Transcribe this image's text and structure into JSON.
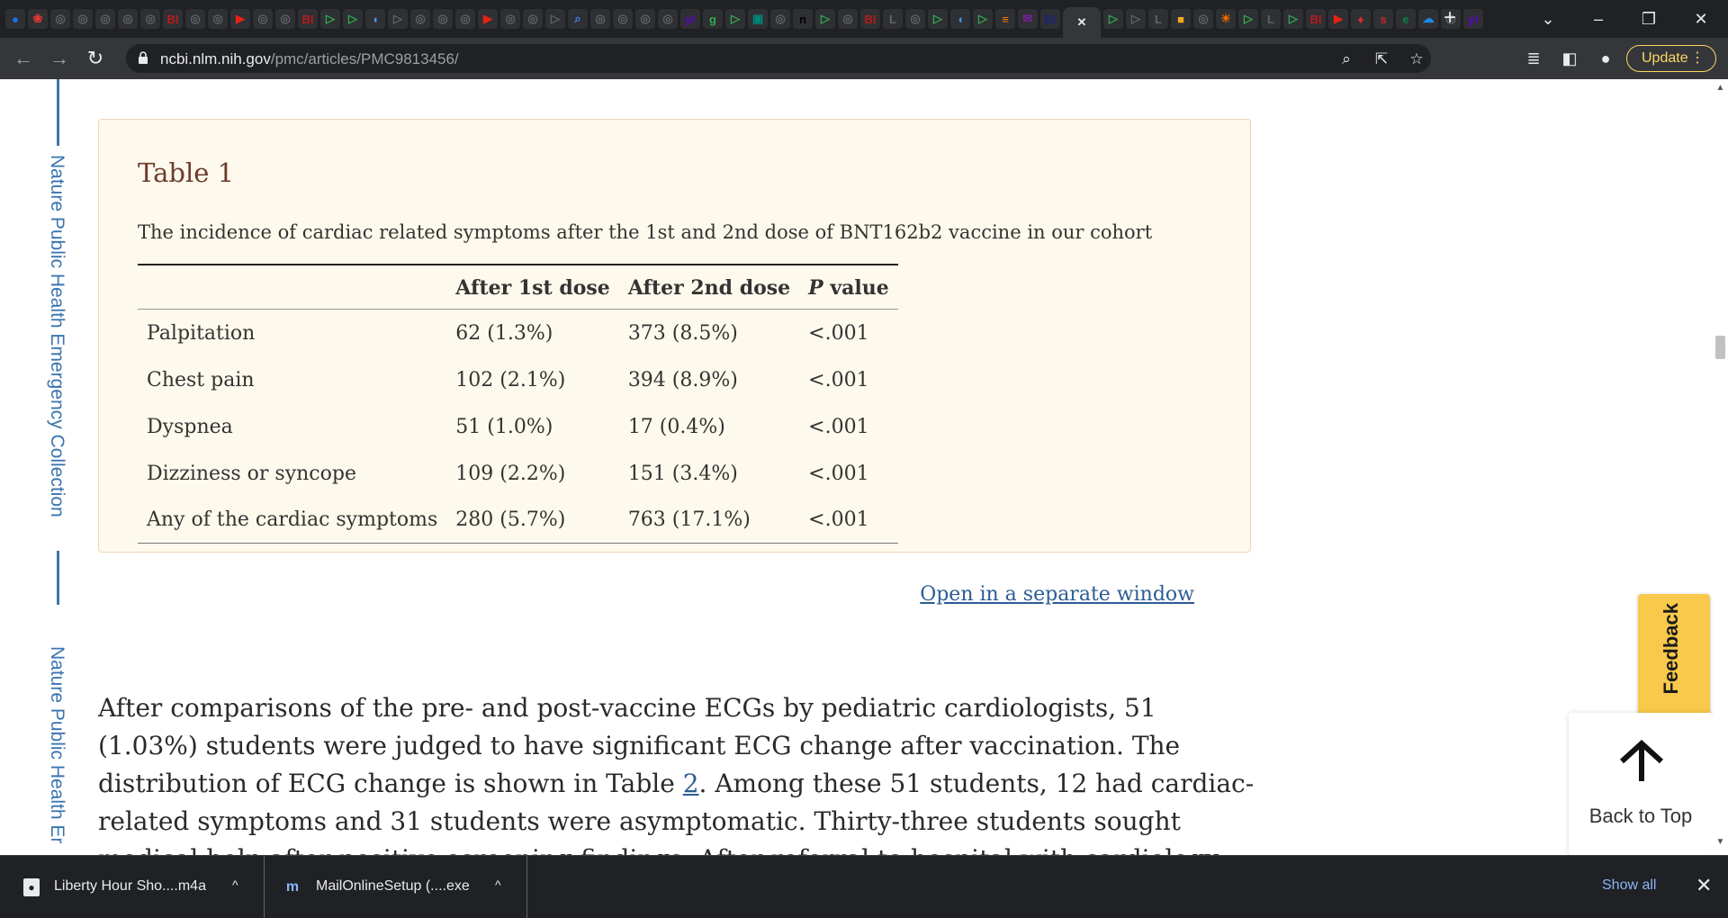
{
  "browser": {
    "tab_favicons": [
      {
        "icon": "globe-favicon",
        "glyph": "●",
        "color": "#1a73e8"
      },
      {
        "icon": "red-star-favicon",
        "glyph": "❀",
        "color": "#e53935"
      },
      {
        "icon": "grey-circle-favicon",
        "glyph": "◎",
        "color": "#5f6368"
      },
      {
        "icon": "grey-circle-favicon",
        "glyph": "◎",
        "color": "#5f6368"
      },
      {
        "icon": "grey-circle-favicon",
        "glyph": "◎",
        "color": "#5f6368"
      },
      {
        "icon": "grey-circle-favicon",
        "glyph": "◎",
        "color": "#5f6368"
      },
      {
        "icon": "grey-circle-favicon",
        "glyph": "◎",
        "color": "#5f6368"
      },
      {
        "icon": "bi-favicon",
        "glyph": "BI",
        "color": "#b71c1c"
      },
      {
        "icon": "grey-circle-favicon",
        "glyph": "◎",
        "color": "#5f6368"
      },
      {
        "icon": "grey-circle-favicon",
        "glyph": "◎",
        "color": "#5f6368"
      },
      {
        "icon": "youtube-favicon",
        "glyph": "▶",
        "color": "#e62117"
      },
      {
        "icon": "grey-circle-favicon",
        "glyph": "◎",
        "color": "#5f6368"
      },
      {
        "icon": "grey-circle-favicon",
        "glyph": "◎",
        "color": "#5f6368"
      },
      {
        "icon": "bi-favicon",
        "glyph": "BI",
        "color": "#b71c1c"
      },
      {
        "icon": "green-play-favicon",
        "glyph": "▷",
        "color": "#34a853"
      },
      {
        "icon": "green-play-favicon",
        "glyph": "▷",
        "color": "#34a853"
      },
      {
        "icon": "shield-favicon",
        "glyph": "◖",
        "color": "#4a90e2"
      },
      {
        "icon": "grey-play-favicon",
        "glyph": "▷",
        "color": "#5f6368"
      },
      {
        "icon": "grey-circle-favicon",
        "glyph": "◎",
        "color": "#5f6368"
      },
      {
        "icon": "grey-circle-favicon",
        "glyph": "◎",
        "color": "#5f6368"
      },
      {
        "icon": "grey-circle-favicon",
        "glyph": "◎",
        "color": "#5f6368"
      },
      {
        "icon": "youtube-favicon",
        "glyph": "▶",
        "color": "#e62117"
      },
      {
        "icon": "grey-circle-favicon",
        "glyph": "◎",
        "color": "#5f6368"
      },
      {
        "icon": "grey-circle-favicon",
        "glyph": "◎",
        "color": "#5f6368"
      },
      {
        "icon": "grey-play-favicon",
        "glyph": "▷",
        "color": "#5f6368"
      },
      {
        "icon": "search-favicon",
        "glyph": "⌕",
        "color": "#4285f4"
      },
      {
        "icon": "grey-circle-favicon",
        "glyph": "◎",
        "color": "#5f6368"
      },
      {
        "icon": "grey-circle-favicon",
        "glyph": "◎",
        "color": "#5f6368"
      },
      {
        "icon": "grey-circle-favicon",
        "glyph": "◎",
        "color": "#5f6368"
      },
      {
        "icon": "grey-circle-favicon",
        "glyph": "◎",
        "color": "#5f6368"
      },
      {
        "icon": "yahoo-favicon",
        "glyph": "y!",
        "color": "#6001d2"
      },
      {
        "icon": "green-g-favicon",
        "glyph": "g",
        "color": "#34a853"
      },
      {
        "icon": "green-play-favicon",
        "glyph": "▷",
        "color": "#34a853"
      },
      {
        "icon": "teal-favicon",
        "glyph": "▣",
        "color": "#00897b"
      },
      {
        "icon": "grey-circle-favicon",
        "glyph": "◎",
        "color": "#5f6368"
      },
      {
        "icon": "n-favicon",
        "glyph": "n",
        "color": "#000000"
      },
      {
        "icon": "green-play-favicon",
        "glyph": "▷",
        "color": "#34a853"
      },
      {
        "icon": "grey-circle-favicon",
        "glyph": "◎",
        "color": "#5f6368"
      },
      {
        "icon": "bi-favicon",
        "glyph": "BI",
        "color": "#b71c1c"
      },
      {
        "icon": "lit-favicon",
        "glyph": "L",
        "color": "#5f6368"
      },
      {
        "icon": "grey-circle-favicon",
        "glyph": "◎",
        "color": "#5f6368"
      },
      {
        "icon": "green-play-favicon",
        "glyph": "▷",
        "color": "#34a853"
      },
      {
        "icon": "shield-favicon",
        "glyph": "◖",
        "color": "#4a90e2"
      },
      {
        "icon": "green-play-favicon",
        "glyph": "▷",
        "color": "#34a853"
      },
      {
        "icon": "orange-bookmark-favicon",
        "glyph": "≡",
        "color": "#f57c00"
      },
      {
        "icon": "purple-mail-favicon",
        "glyph": "✉",
        "color": "#7b1fa2"
      },
      {
        "icon": "ei-favicon",
        "glyph": "EI",
        "color": "#1a237e"
      }
    ],
    "active_tab_close": "✕",
    "tab_favicons_after": [
      {
        "icon": "green-play-favicon",
        "glyph": "▷",
        "color": "#34a853"
      },
      {
        "icon": "grey-play-favicon",
        "glyph": "▷",
        "color": "#5f6368"
      },
      {
        "icon": "lit-favicon",
        "glyph": "L",
        "color": "#5f6368"
      },
      {
        "icon": "yellow-favicon",
        "glyph": "■",
        "color": "#f9a825"
      },
      {
        "icon": "grey-circle-favicon",
        "glyph": "◎",
        "color": "#5f6368"
      },
      {
        "icon": "orange-sun-favicon",
        "glyph": "☀",
        "color": "#ef6c00"
      },
      {
        "icon": "green-play-favicon",
        "glyph": "▷",
        "color": "#34a853"
      },
      {
        "icon": "lit-favicon",
        "glyph": "L",
        "color": "#5f6368"
      },
      {
        "icon": "green-play-favicon",
        "glyph": "▷",
        "color": "#34a853"
      },
      {
        "icon": "bi-favicon",
        "glyph": "BI",
        "color": "#b71c1c"
      },
      {
        "icon": "youtube-favicon",
        "glyph": "▶",
        "color": "#e62117"
      },
      {
        "icon": "red-favicon",
        "glyph": "♦",
        "color": "#d32f2f"
      },
      {
        "icon": "s-favicon",
        "glyph": "s",
        "color": "#c62828"
      },
      {
        "icon": "edge-favicon",
        "glyph": "e",
        "color": "#0b8043"
      },
      {
        "icon": "cloud-favicon",
        "glyph": "☁",
        "color": "#1e88e5"
      },
      {
        "icon": "grey-circle-favicon",
        "glyph": "◎",
        "color": "#5f6368"
      },
      {
        "icon": "yahoo-favicon",
        "glyph": "y!",
        "color": "#6001d2"
      }
    ],
    "new_tab": "+",
    "minimize": "–",
    "restore": "❐",
    "close": "✕",
    "tab_search": "⌄",
    "back": "←",
    "forward": "→",
    "reload": "↻",
    "url_host": "ncbi.nlm.nih.gov",
    "url_path": "/pmc/articles/PMC9813456/",
    "zoom_icon": "⌕",
    "share_icon": "⇱",
    "bookmark_icon": "☆",
    "reading_list_icon": "≣",
    "sidepanel_icon": "◧",
    "profile_icon": "●",
    "update_label": "Update",
    "update_menu": "⋮"
  },
  "page": {
    "collection_text_1": "Nature Public Health Emergency Collection",
    "collection_text_2": "Nature Public Health Er",
    "table": {
      "title": "Table 1",
      "caption": "The incidence of cardiac related symptoms after the 1st and 2nd dose of BNT162b2 vaccine in our cohort",
      "headers": [
        "",
        "After 1st dose",
        "After 2nd dose",
        "value"
      ],
      "header_p": "P",
      "rows": [
        [
          "Palpitation",
          "62 (1.3%)",
          "373 (8.5%)",
          "<.001"
        ],
        [
          "Chest pain",
          "102 (2.1%)",
          "394 (8.9%)",
          "<.001"
        ],
        [
          "Dyspnea",
          "51 (1.0%)",
          "17 (0.4%)",
          "<.001"
        ],
        [
          "Dizziness or syncope",
          "109 (2.2%)",
          "151 (3.4%)",
          "<.001"
        ],
        [
          "Any of the cardiac symptoms",
          "280 (5.7%)",
          "763 (17.1%)",
          "<.001"
        ]
      ],
      "open_link": "Open in a separate window"
    },
    "paragraph_before_link": "After comparisons of the pre- and post-vaccine ECGs by pediatric cardiologists, 51 (1.03%) students were judged to have significant ECG change after vaccination. The distribution of ECG change is shown in Table ",
    "paragraph_link": "2",
    "paragraph_after_link": ". Among these 51 students, 12 had cardiac-related symptoms and 31 students were asymptomatic. Thirty-three students sought medical help after positive screening findings. After referral to hospital with cardiology evaluation, including troponin-T, C-reactive",
    "feedback_label": "Feedback",
    "back_to_top": "Back to Top",
    "scroll_up": "▲",
    "scroll_down": "▼"
  },
  "downloads": {
    "items": [
      {
        "name": "Liberty Hour Sho....m4a",
        "icon_glyph": "●",
        "caret": "^"
      },
      {
        "name": "MailOnlineSetup (....exe",
        "icon_glyph": "m",
        "caret": "^"
      }
    ],
    "show_all": "Show all",
    "close": "✕"
  }
}
